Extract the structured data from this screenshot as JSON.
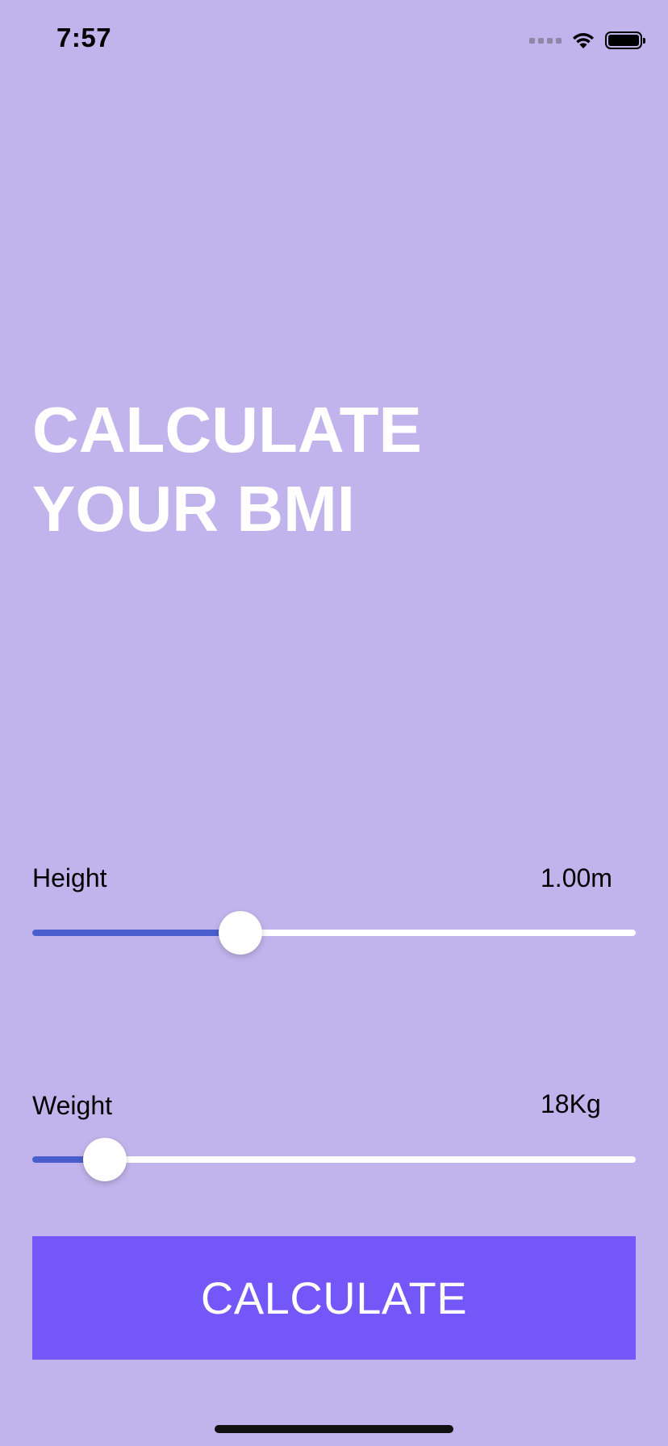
{
  "status_bar": {
    "time": "7:57",
    "signal_icon": "cellular-signal-icon",
    "wifi_icon": "wifi-icon",
    "battery_icon": "battery-icon",
    "battery_level": 1.0
  },
  "title": {
    "line1": "CALCULATE",
    "line2": "YOUR BMI"
  },
  "height_slider": {
    "label": "Height",
    "value_text": "1.00m",
    "fraction": 0.345
  },
  "weight_slider": {
    "label": "Weight",
    "value_text": "18Kg",
    "fraction": 0.12
  },
  "calculate_button": {
    "label": "CALCULATE"
  },
  "colors": {
    "background": "#C1B4EC",
    "slider_fill": "#4A5ECD",
    "slider_track": "#FFFFFF",
    "button": "#7357F8",
    "title_text": "#FFFFFF"
  }
}
